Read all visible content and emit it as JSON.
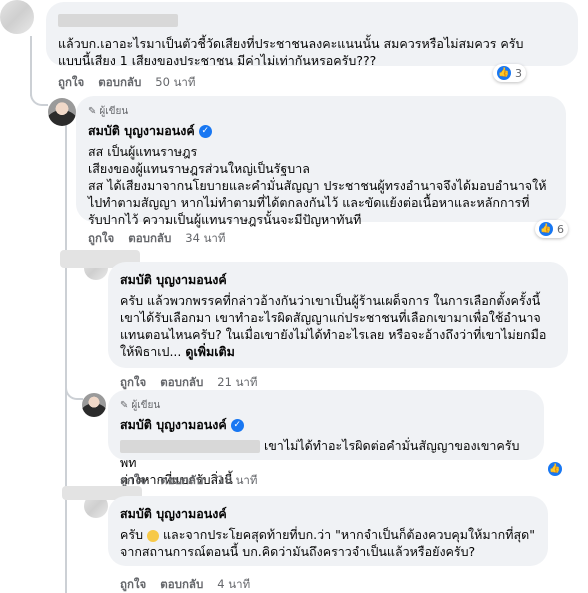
{
  "comments": [
    {
      "author": "",
      "text_lines": [
        "แล้วบก.เอาอะไรมาเป็นตัวชี้วัดเสียงที่ประชาชนลงคะแนนนั้น สมควรหรือไม่สมควร ครับ",
        "แบบนี้เสียง 1 เสียงของประชาชน มีค่าไม่เท่ากันหรอครับ???"
      ],
      "like_label": "ถูกใจ",
      "reply_label": "ตอบกลับ",
      "time": "50 นาที",
      "reaction_count": "3"
    },
    {
      "badge": "ผู้เขียน",
      "author": "สมบัติ บุญงามอนงค์",
      "text_lines": [
        "สส เป็นผู้แทนราษฎร",
        "เสียงของผู้แทนราษฎรส่วนใหญ่เป็นรัฐบาล",
        "สส ได้เสียงมาจากนโยบายและคำมั่นสัญญา ประชาชนผู้ทรงอำนาจจึงได้มอบอำนาจให้",
        "ไปทำตามสัญญา หากไม่ทำตามที่ได้ตกลงกันไว้ และขัดแย้งต่อเนื้อหาและหลักการที่",
        "รับปากไว้ ความเป็นผู้แทนราษฎรนั้นจะมีปัญหาทันที"
      ],
      "like_label": "ถูกใจ",
      "reply_label": "ตอบกลับ",
      "time": "34 นาที",
      "reaction_count": "6"
    },
    {
      "author": "สมบัติ บุญงามอนงค์",
      "text_lines": [
        "ครับ แล้วพวกพรรคที่กล่าวอ้างกันว่าเขาเป็นผู้ร้านเผด็จการ ในการเลือกตั้งครั้งนี้",
        "เขาได้รับเลือกมา เขาทำอะไรผิดสัญญาแก่ประชาชนที่เลือกเขามาเพื่อใช้อำนาจ",
        "แทนตอนไหนครับ? ในเมื่อเขายังไม่ได้ทำอะไรเลย หรือจะอ้างถึงว่าที่เขาไม่ยกมือ",
        "ให้พิธาเป..."
      ],
      "see_more": "ดูเพิ่มเติม",
      "like_label": "ถูกใจ",
      "reply_label": "ตอบกลับ",
      "time": "21 นาที"
    },
    {
      "badge": "ผู้เขียน",
      "author": "สมบัติ บุญงามอนงค์",
      "text_line1": "เขาไม่ได้ทำอะไรผิดต่อคำมั่นสัญญาของเขาครับ พท",
      "text_line2": "ต่างหากที่แบกรับสิ่งนี้",
      "like_label": "ถูกใจ",
      "reply_label": "ตอบกลับ",
      "time": "18 นาที"
    },
    {
      "author": "สมบัติ บุญงามอนงค์",
      "text_line1": "ครับ",
      "text_line1b": "และจากประโยคสุดท้ายที่บก.ว่า \"หากจำเป็นก็ต้องควบคุมให้มากที่สุด\"",
      "text_line2": "จากสถานการณ์ตอนนี้ บก.คิดว่ามันถึงคราวจำเป็นแล้วหรือยังครับ?",
      "like_label": "ถูกใจ",
      "reply_label": "ตอบกลับ",
      "time": "4 นาที"
    }
  ],
  "icons": {
    "verified": "verified-check-icon",
    "pencil": "pencil-icon",
    "like": "like-thumb-icon",
    "smile": "smile-emoji-icon"
  },
  "colors": {
    "bubble": "#f0f2f5",
    "link_blue": "#1877f2",
    "meta": "#65676b"
  }
}
